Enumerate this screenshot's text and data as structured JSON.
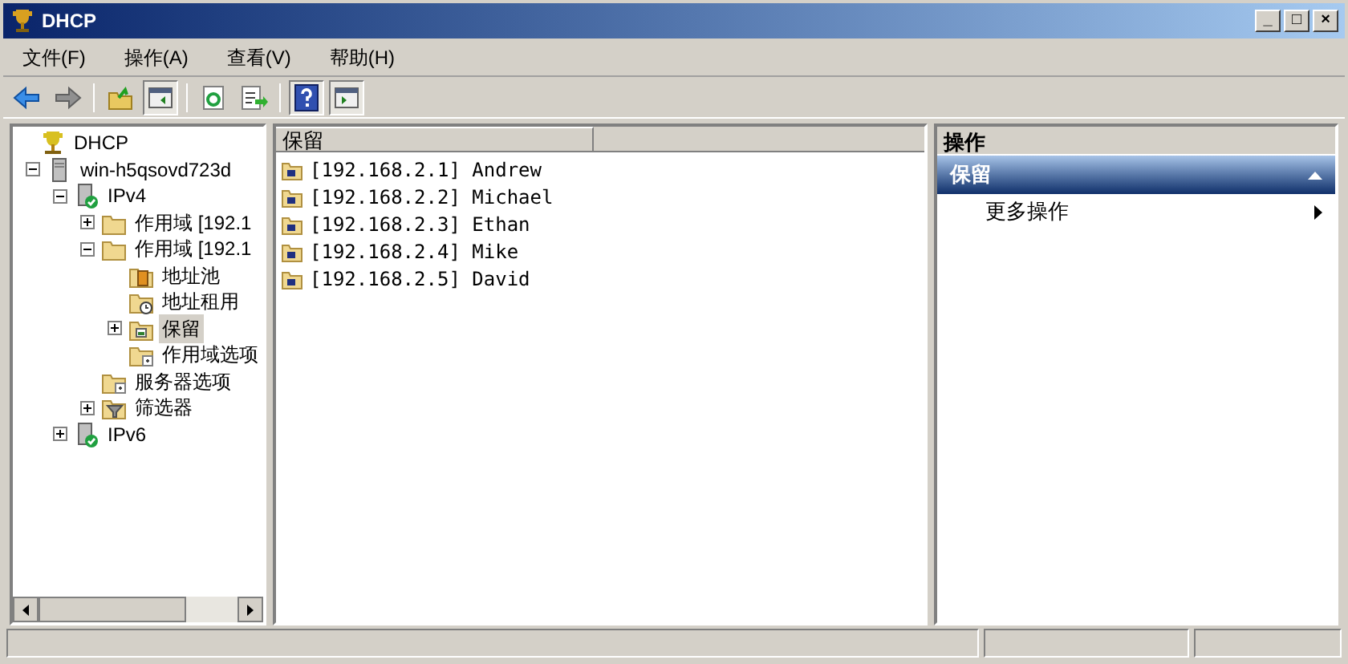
{
  "window": {
    "title": "DHCP",
    "controls": [
      "_",
      "□",
      "×"
    ]
  },
  "menu": [
    "文件(F)",
    "操作(A)",
    "查看(V)",
    "帮助(H)"
  ],
  "toolbar": [
    {
      "kind": "back"
    },
    {
      "kind": "forward"
    },
    {
      "kind": "sep"
    },
    {
      "kind": "up"
    },
    {
      "kind": "pane",
      "selected": true
    },
    {
      "kind": "sep"
    },
    {
      "kind": "refresh"
    },
    {
      "kind": "export"
    },
    {
      "kind": "sep"
    },
    {
      "kind": "help",
      "selected": true
    },
    {
      "kind": "pane2",
      "selected": true
    }
  ],
  "tree": [
    {
      "label": "DHCP",
      "kind": "dhcp",
      "selected": false,
      "children": [
        {
          "label": "win-h5qsovd723d",
          "kind": "server",
          "expanded": true,
          "selected": false,
          "children": [
            {
              "label": "IPv4",
              "kind": "serverok",
              "expanded": true,
              "selected": false,
              "children": [
                {
                  "label": "作用域 [192.1",
                  "kind": "folder",
                  "expanded": false,
                  "selected": false
                },
                {
                  "label": "作用域 [192.1",
                  "kind": "folder",
                  "expanded": true,
                  "selected": false,
                  "children": [
                    {
                      "label": "地址池",
                      "kind": "pool",
                      "selected": false
                    },
                    {
                      "label": "地址租用",
                      "kind": "lease",
                      "selected": false
                    },
                    {
                      "label": "保留",
                      "kind": "reserve",
                      "expanded": false,
                      "selected": true
                    },
                    {
                      "label": "作用域选项",
                      "kind": "options",
                      "selected": false
                    }
                  ]
                },
                {
                  "label": "服务器选项",
                  "kind": "options",
                  "selected": false
                },
                {
                  "label": "筛选器",
                  "kind": "filter",
                  "expanded": false,
                  "selected": false
                }
              ]
            },
            {
              "label": "IPv6",
              "kind": "serverok",
              "expanded": false,
              "selected": false
            }
          ]
        }
      ]
    }
  ],
  "list": {
    "columns": [
      "保留"
    ],
    "rows": [
      "[192.168.2.1] Andrew",
      "[192.168.2.2] Michael",
      "[192.168.2.3] Ethan",
      "[192.168.2.4] Mike",
      "[192.168.2.5] David"
    ]
  },
  "actions": {
    "title": "操作",
    "section": "保留",
    "items": [
      "更多操作"
    ]
  }
}
